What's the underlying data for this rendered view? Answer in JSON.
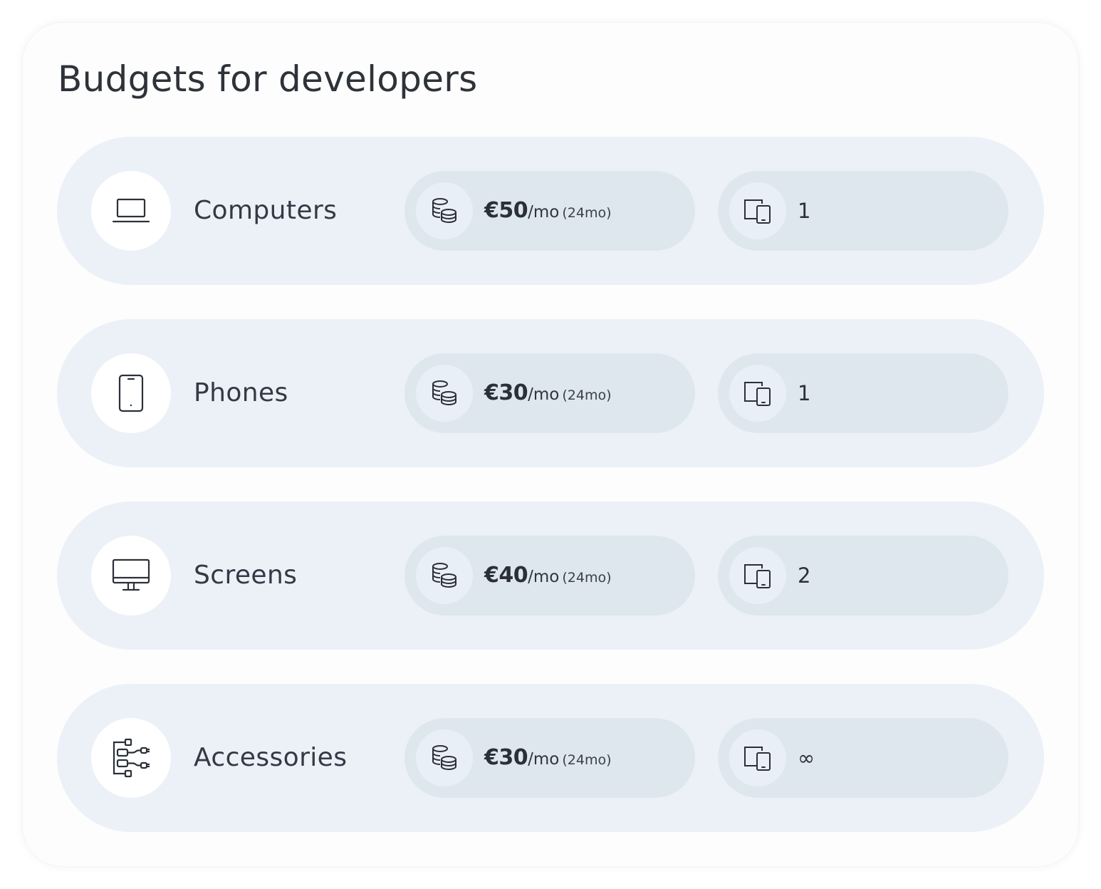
{
  "title": "Budgets for developers",
  "categories": [
    {
      "label": "Computers",
      "icon": "laptop-icon",
      "amount": "€50",
      "per": "/mo",
      "term": "(24mo)",
      "quantity": "1"
    },
    {
      "label": "Phones",
      "icon": "phone-icon",
      "amount": "€30",
      "per": "/mo",
      "term": "(24mo)",
      "quantity": "1"
    },
    {
      "label": "Screens",
      "icon": "monitor-icon",
      "amount": "€40",
      "per": "/mo",
      "term": "(24mo)",
      "quantity": "2"
    },
    {
      "label": "Accessories",
      "icon": "cable-icon",
      "amount": "€30",
      "per": "/mo",
      "term": "(24mo)",
      "quantity": "∞"
    }
  ],
  "colors": {
    "row_background": "#ecf1f8",
    "pill_background": "#dfe7ee",
    "text": "#2b3038"
  }
}
